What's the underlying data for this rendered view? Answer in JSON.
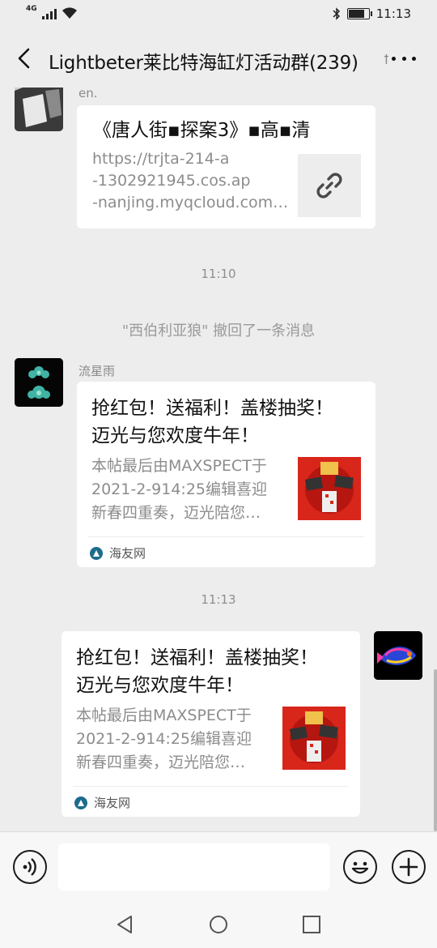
{
  "status_bar": {
    "network": "4G",
    "time": "11:13",
    "battery_level": 0.85
  },
  "title_bar": {
    "title": "Lightbeter莱比特海缸灯活动群(239)"
  },
  "messages": {
    "link_card": {
      "sender": "en.",
      "title": "《唐人街▪探案3》▪高▪清",
      "desc_lines": [
        "https://trjta-214-a",
        "-1302921945.cos.ap",
        "-nanjing.myqcloud.com…"
      ]
    },
    "time_1": "11:10",
    "recall_notice": "\"西伯利亚狼\" 撤回了一条消息",
    "shared_card_1": {
      "sender": "流星雨",
      "title_lines": [
        "抢红包！送福利！盖楼抽奖！",
        "迈光与您欢度牛年！"
      ],
      "desc_lines": [
        "本帖最后由MAXSPECT于",
        "2021-2-914:25编辑喜迎",
        "新春四重奏，迈光陪您…"
      ],
      "source": "海友网"
    },
    "time_2": "11:13",
    "shared_card_2": {
      "title_lines": [
        "抢红包！送福利！盖楼抽奖！",
        "迈光与您欢度牛年！"
      ],
      "desc_lines": [
        "本帖最后由MAXSPECT于",
        "2021-2-914:25编辑喜迎",
        "新春四重奏，迈光陪您…"
      ],
      "source": "海友网"
    }
  },
  "input_bar": {
    "message_value": ""
  },
  "colors": {
    "background": "#ededed",
    "card": "#ffffff",
    "red_packet": "#d8261b"
  }
}
